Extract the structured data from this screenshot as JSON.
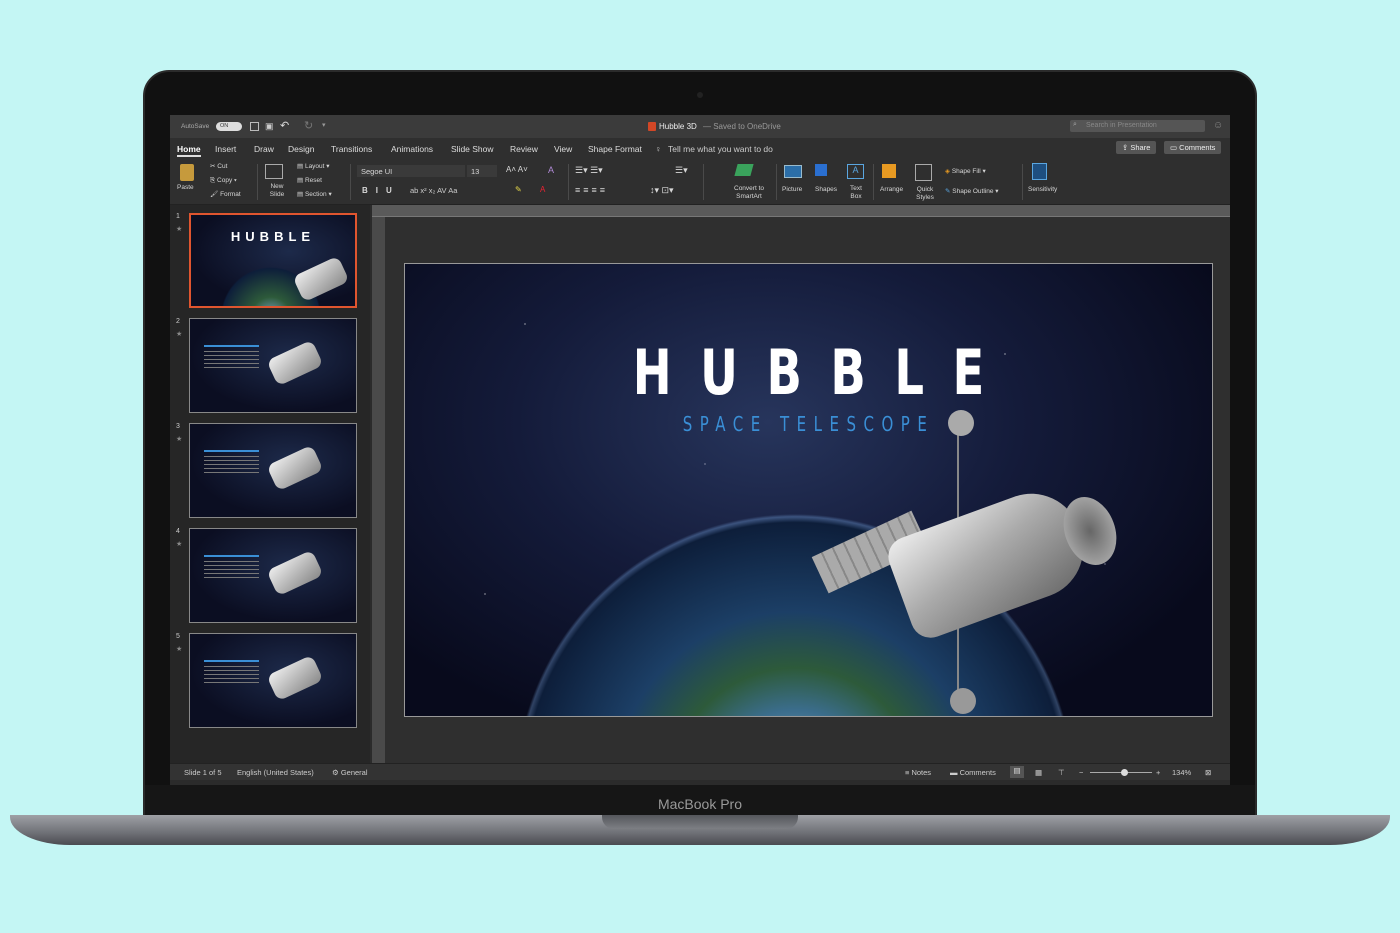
{
  "device": {
    "brand": "MacBook Pro"
  },
  "titlebar": {
    "autosave_label": "AutoSave",
    "autosave_state": "ON",
    "doc_title": "Hubble 3D",
    "save_status": "— Saved to OneDrive",
    "search_placeholder": "Search in Presentation"
  },
  "tabs": [
    "Home",
    "Insert",
    "Draw",
    "Design",
    "Transitions",
    "Animations",
    "Slide Show",
    "Review",
    "View",
    "Shape Format"
  ],
  "tell_me": "Tell me what you want to do",
  "share_label": "Share",
  "comments_label": "Comments",
  "ribbon": {
    "paste": "Paste",
    "cut": "Cut",
    "copy": "Copy",
    "format": "Format",
    "new_slide": "New Slide",
    "layout": "Layout",
    "reset": "Reset",
    "section": "Section",
    "font": "Segoe UI",
    "font_size": "13",
    "convert_smartart": "Convert to SmartArt",
    "picture": "Picture",
    "shapes": "Shapes",
    "text_box": "Text Box",
    "arrange": "Arrange",
    "quick_styles": "Quick Styles",
    "shape_fill": "Shape Fill",
    "shape_outline": "Shape Outline",
    "sensitivity": "Sensitivity"
  },
  "slides": [
    {
      "num": "1"
    },
    {
      "num": "2"
    },
    {
      "num": "3"
    },
    {
      "num": "4"
    },
    {
      "num": "5"
    }
  ],
  "slide": {
    "title": "HUBBLE",
    "subtitle": "SPACE TELESCOPE"
  },
  "status": {
    "slide_of": "Slide 1 of 5",
    "language": "English (United States)",
    "sensitivity": "General",
    "notes": "Notes",
    "comments": "Comments",
    "zoom": "134%",
    "zoom_fraction": 0.55
  },
  "colors": {
    "accent": "#e0552f",
    "subtitle": "#3a8fd6",
    "background": "#c4f6f4"
  }
}
